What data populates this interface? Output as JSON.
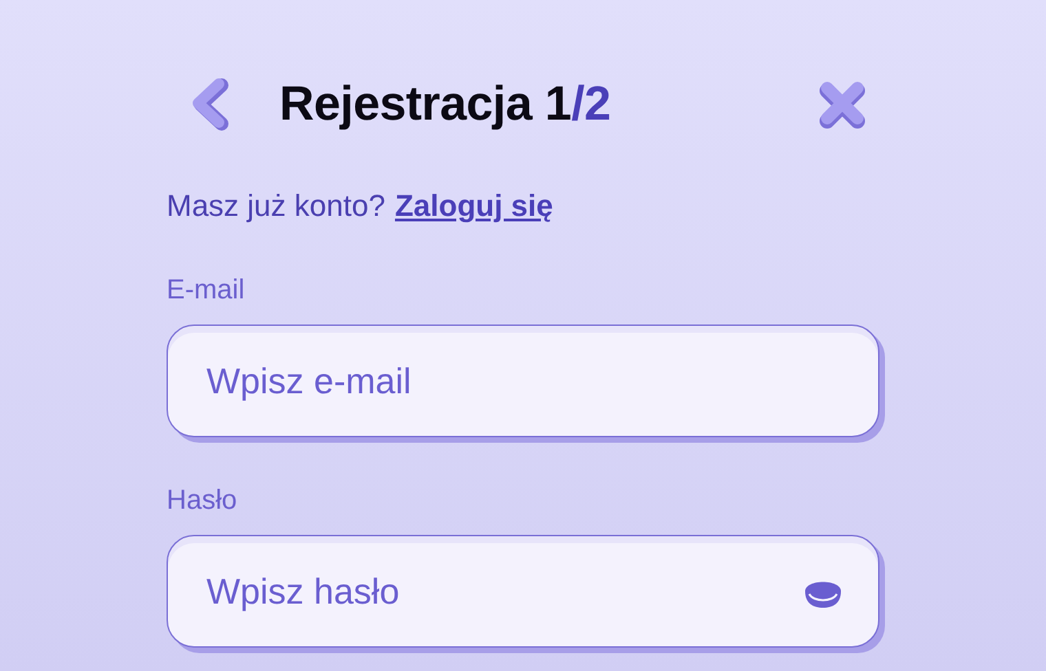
{
  "header": {
    "title": "Rejestracja 1",
    "title_step": "/2"
  },
  "login_prompt": {
    "text": "Masz już konto?",
    "link": "Zaloguj się"
  },
  "fields": [
    {
      "label": "E-mail",
      "placeholder": "Wpisz e-mail",
      "kind": "text"
    },
    {
      "label": "Hasło",
      "placeholder": "Wpisz hasło",
      "kind": "password"
    }
  ]
}
